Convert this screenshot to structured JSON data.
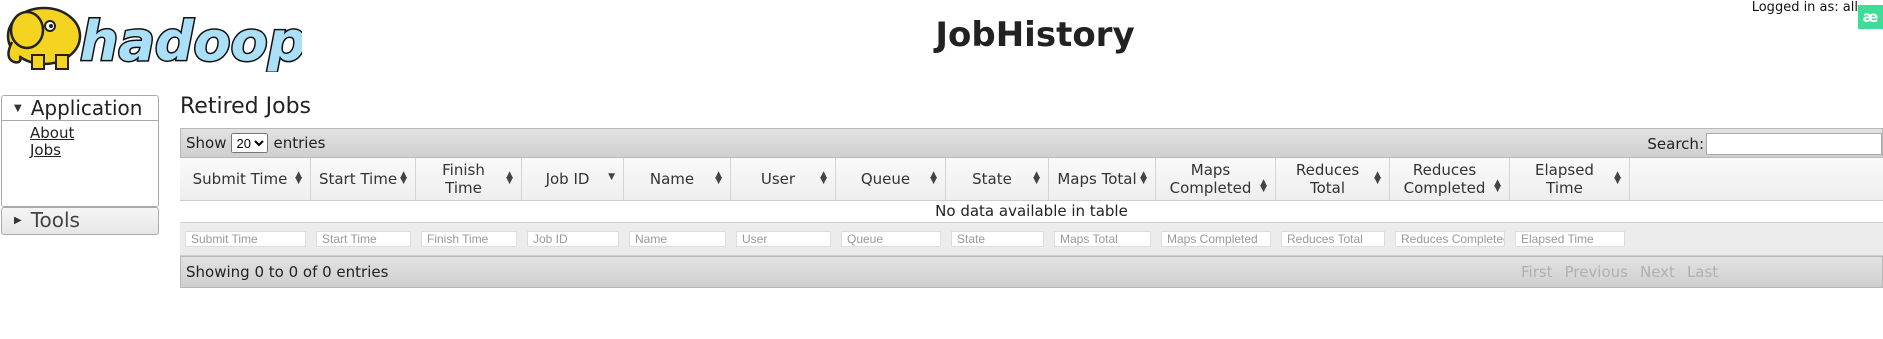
{
  "header": {
    "logo_text": "hadoop",
    "title": "JobHistory",
    "logged_in": "Logged in as: all",
    "user_badge": "æ"
  },
  "sidebar": {
    "sections": [
      {
        "label": "Application",
        "items": [
          {
            "label": "About"
          },
          {
            "label": "Jobs"
          }
        ]
      },
      {
        "label": "Tools"
      }
    ]
  },
  "main": {
    "title": "Retired Jobs",
    "show_label": "Show",
    "page_size": "20",
    "entries_label": "entries",
    "search_label": "Search:",
    "search_value": "",
    "columns": [
      "Submit Time",
      "Start Time",
      "Finish Time",
      "Job ID",
      "Name",
      "User",
      "Queue",
      "State",
      "Maps Total",
      "Maps Completed",
      "Reduces Total",
      "Reduces Completed",
      "Elapsed Time"
    ],
    "empty_message": "No data available in table",
    "filters": [
      "Submit Time",
      "Start Time",
      "Finish Time",
      "Job ID",
      "Name",
      "User",
      "Queue",
      "State",
      "Maps Total",
      "Maps Completed",
      "Reduces Total",
      "Reduces Completed",
      "Elapsed Time"
    ],
    "info": "Showing 0 to 0 of 0 entries",
    "pager": {
      "first": "First",
      "previous": "Previous",
      "next": "Next",
      "last": "Last"
    }
  }
}
